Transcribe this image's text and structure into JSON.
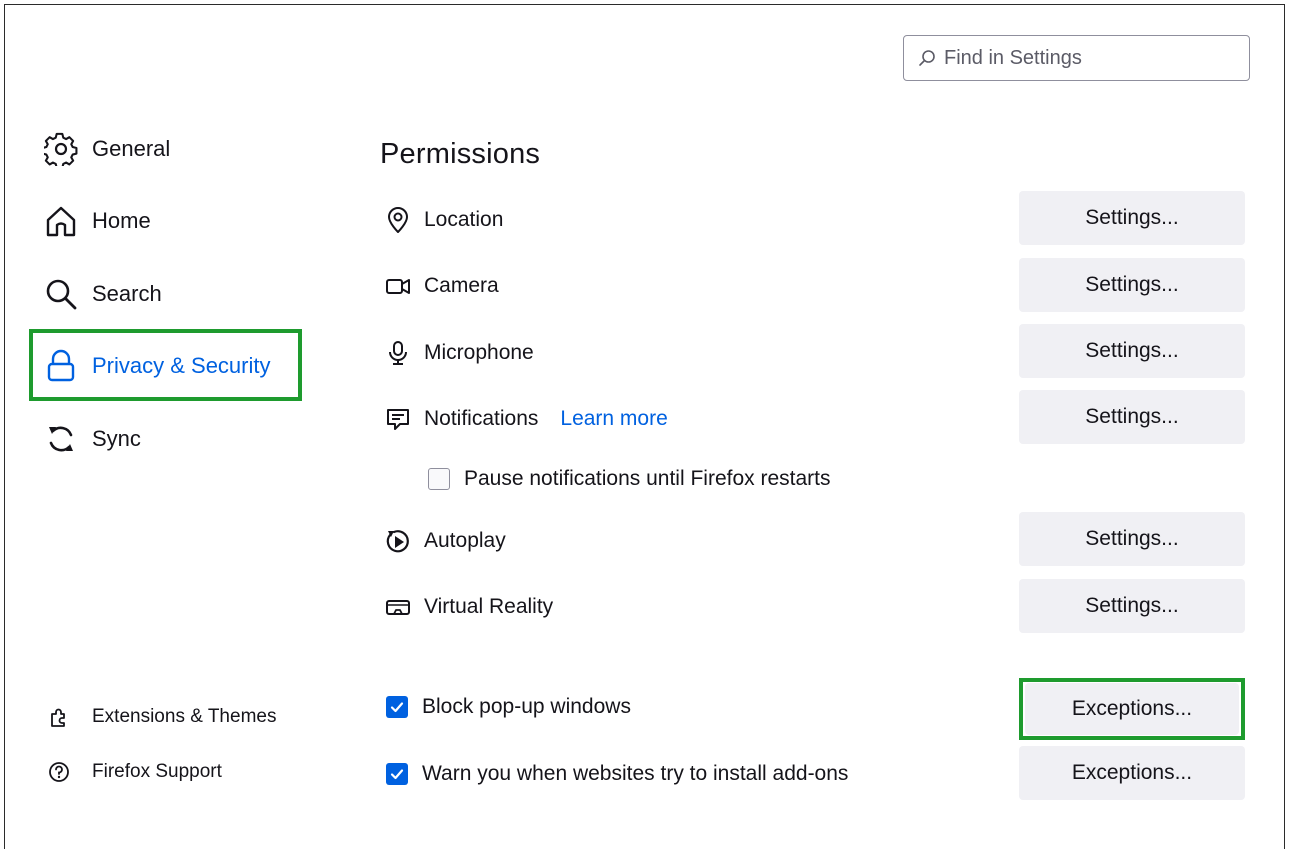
{
  "search": {
    "placeholder": "Find in Settings"
  },
  "sidebar": {
    "items": [
      {
        "label": "General"
      },
      {
        "label": "Home"
      },
      {
        "label": "Search"
      },
      {
        "label": "Privacy & Security",
        "selected": true
      },
      {
        "label": "Sync"
      }
    ],
    "footer": [
      {
        "label": "Extensions & Themes"
      },
      {
        "label": "Firefox Support"
      }
    ]
  },
  "permissions": {
    "title": "Permissions",
    "rows": [
      {
        "label": "Location",
        "icon": "location-pin-icon",
        "button": "Settings..."
      },
      {
        "label": "Camera",
        "icon": "camera-icon",
        "button": "Settings..."
      },
      {
        "label": "Microphone",
        "icon": "microphone-icon",
        "button": "Settings..."
      },
      {
        "label": "Notifications",
        "icon": "notification-icon",
        "button": "Settings...",
        "link": "Learn more"
      },
      {
        "label": "Autoplay",
        "icon": "autoplay-icon",
        "button": "Settings..."
      },
      {
        "label": "Virtual Reality",
        "icon": "vr-headset-icon",
        "button": "Settings..."
      }
    ],
    "pause_notifications": {
      "label": "Pause notifications until Firefox restarts",
      "checked": false
    },
    "block_popups": {
      "label": "Block pop-up windows",
      "checked": true,
      "button": "Exceptions..."
    },
    "warn_addons": {
      "label": "Warn you when websites try to install add-ons",
      "checked": true,
      "button": "Exceptions..."
    }
  },
  "colors": {
    "accent": "#0061e0",
    "highlight": "#1e9b2e",
    "button_bg": "#f0f0f4"
  }
}
